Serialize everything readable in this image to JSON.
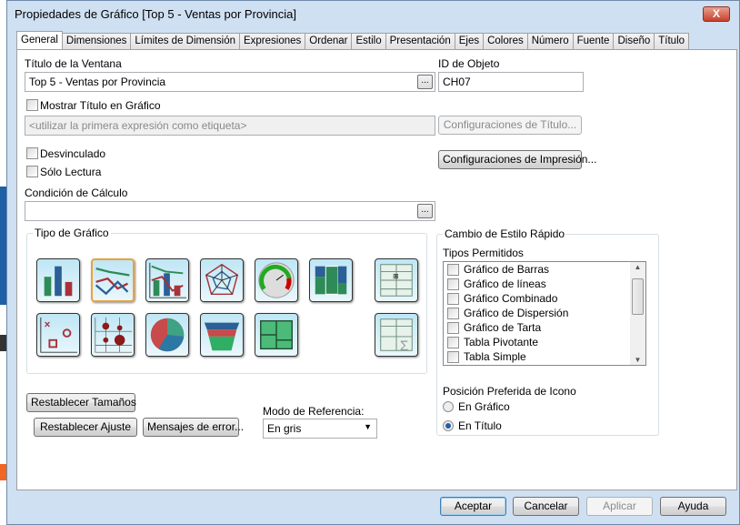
{
  "window": {
    "title": "Propiedades de Gráfico [Top 5 - Ventas por Provincia]",
    "close": "X"
  },
  "tabs": [
    "General",
    "Dimensiones",
    "Límites de Dimensión",
    "Expresiones",
    "Ordenar",
    "Estilo",
    "Presentación",
    "Ejes",
    "Colores",
    "Número",
    "Fuente",
    "Diseño",
    "Título"
  ],
  "general": {
    "window_title_label": "Título de la Ventana",
    "window_title_value": "Top 5 - Ventas por Provincia",
    "object_id_label": "ID de Objeto",
    "object_id_value": "CH07",
    "show_title_label": "Mostrar Título en Gráfico",
    "show_title_placeholder": "<utilizar la primera expresión como etiqueta>",
    "title_settings": "Configuraciones de Título...",
    "print_settings": "Configuraciones de Impresión...",
    "detached": "Desvinculado",
    "read_only": "Sólo Lectura",
    "calc_condition_label": "Condición de Cálculo",
    "ellipsis": "...",
    "chart_type_label": "Tipo de Gráfico",
    "chart_types": [
      "bar",
      "line",
      "combo",
      "radar",
      "gauge",
      "mekko",
      "pivot",
      "scatter",
      "grid",
      "pie",
      "funnel",
      "block",
      "straight-table"
    ],
    "selected_chart_type": "line",
    "reset_sizes": "Restablecer Tamaños",
    "reset_fit": "Restablecer Ajuste",
    "error_messages": "Mensajes de error...",
    "reference_mode_label": "Modo de Referencia:",
    "reference_mode_value": "En gris",
    "quick_style_label": "Cambio de Estilo Rápido",
    "allowed_types_label": "Tipos Permitidos",
    "allowed_types": [
      "Gráfico de Barras",
      "Gráfico de líneas",
      "Gráfico Combinado",
      "Gráfico de Dispersión",
      "Gráfico de Tarta",
      "Tabla Pivotante",
      "Tabla Simple"
    ],
    "icon_position_label": "Posición Preferida de Icono",
    "icon_position_options": [
      "En Gráfico",
      "En Título"
    ],
    "icon_position_selected": "En Título"
  },
  "footer": {
    "ok": "Aceptar",
    "cancel": "Cancelar",
    "apply": "Aplicar",
    "help": "Ayuda"
  }
}
